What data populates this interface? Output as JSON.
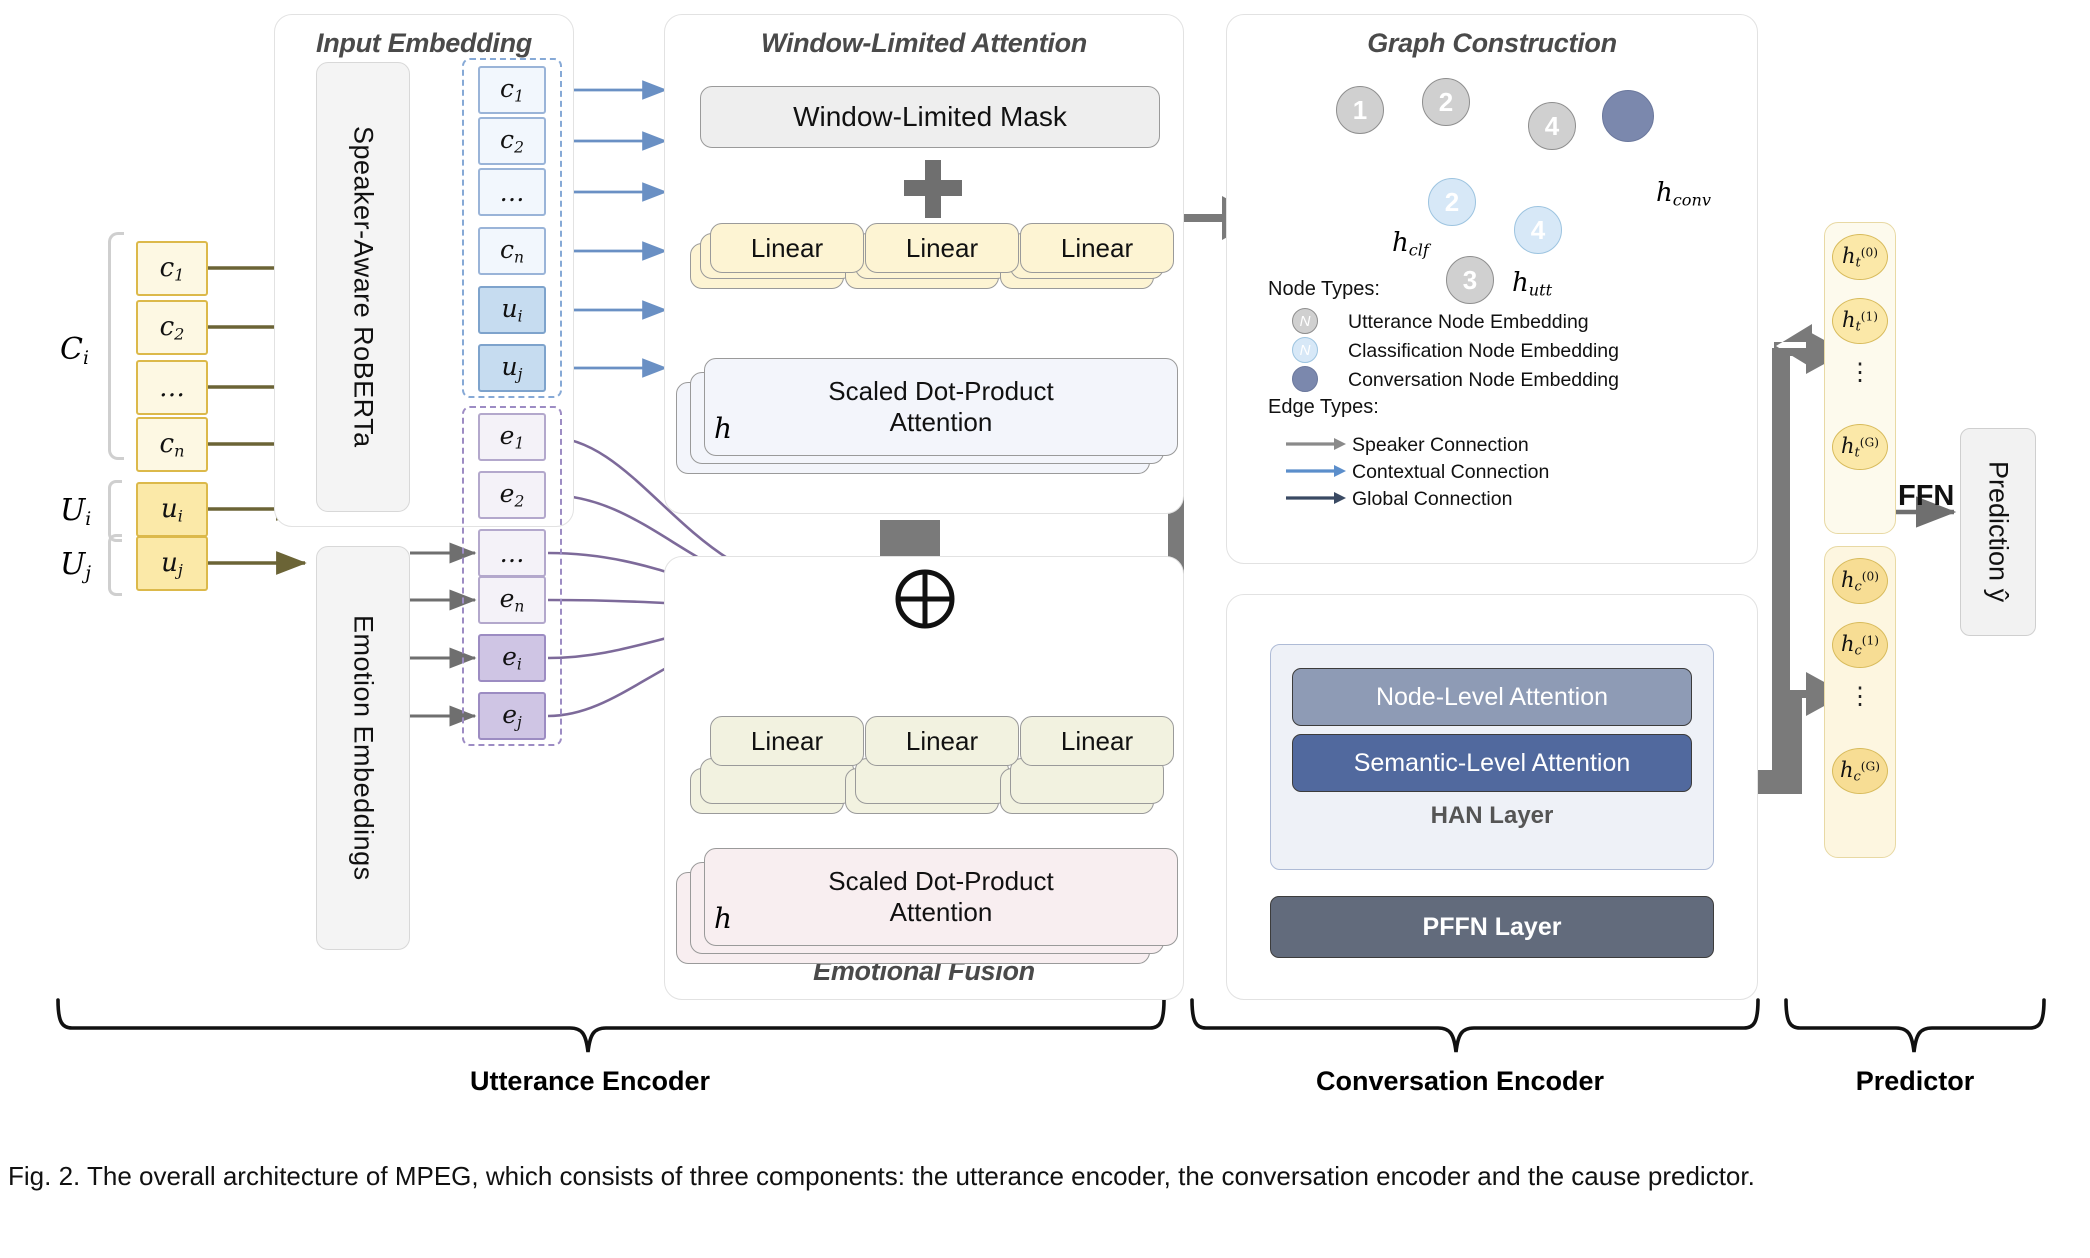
{
  "figure": {
    "caption": "Fig. 2. The overall architecture of MPEG, which consists of three components: the utterance encoder, the conversation encoder and the cause predictor."
  },
  "inputs": {
    "group_c_label": "C",
    "group_c_sub": "i",
    "group_ui_label": "U",
    "group_ui_sub": "i",
    "group_uj_label": "U",
    "group_uj_sub": "j",
    "context_tokens": [
      {
        "base": "c",
        "sub": "1"
      },
      {
        "base": "c",
        "sub": "2"
      },
      {
        "base": "…",
        "sub": ""
      },
      {
        "base": "c",
        "sub": "n"
      }
    ],
    "utterance_tokens": [
      {
        "base": "u",
        "sub": "i"
      },
      {
        "base": "u",
        "sub": "j"
      }
    ]
  },
  "input_embedding": {
    "title": "Input Embedding",
    "encoder_label": "Speaker-Aware RoBERTa",
    "emotion_label": "Emotion Embeddings",
    "text_embeddings": [
      {
        "base": "c",
        "sub": "1",
        "strong": false
      },
      {
        "base": "c",
        "sub": "2",
        "strong": false
      },
      {
        "base": "…",
        "sub": "",
        "strong": false
      },
      {
        "base": "c",
        "sub": "n",
        "strong": false
      },
      {
        "base": "u",
        "sub": "i",
        "strong": true
      },
      {
        "base": "u",
        "sub": "j",
        "strong": true
      }
    ],
    "emotion_embeddings": [
      {
        "base": "e",
        "sub": "1",
        "strong": false
      },
      {
        "base": "e",
        "sub": "2",
        "strong": false
      },
      {
        "base": "…",
        "sub": "",
        "strong": false
      },
      {
        "base": "e",
        "sub": "n",
        "strong": false
      },
      {
        "base": "e",
        "sub": "i",
        "strong": true
      },
      {
        "base": "e",
        "sub": "j",
        "strong": true
      }
    ]
  },
  "window_attention": {
    "title": "Window-Limited Attention",
    "mask_label": "Window-Limited Mask",
    "plus_symbol": "+",
    "linear_labels": [
      "Linear",
      "Linear",
      "Linear"
    ],
    "sdpa_label_line1": "Scaled Dot-Product",
    "sdpa_label_line2": "Attention",
    "heads_symbol": "h"
  },
  "emotional_fusion": {
    "title": "Emotional Fusion",
    "sum_symbol": "⊕",
    "linear_labels": [
      "Linear",
      "Linear",
      "Linear"
    ],
    "sdpa_label_line1": "Scaled Dot-Product",
    "sdpa_label_line2": "Attention",
    "heads_symbol": "h"
  },
  "graph_construction": {
    "title": "Graph Construction",
    "utterance_nodes": [
      "1",
      "2",
      "4",
      "3"
    ],
    "classification_nodes": [
      "2",
      "4"
    ],
    "conversation_node_label": "",
    "annotations": {
      "h_clf": {
        "base": "h",
        "sub": "clf"
      },
      "h_utt": {
        "base": "h",
        "sub": "utt"
      },
      "h_conv": {
        "base": "h",
        "sub": "conv"
      }
    },
    "node_types_heading": "Node Types:",
    "node_types": [
      {
        "glyph": "N",
        "label": "Utterance Node Embedding",
        "color": "#d0d0d0"
      },
      {
        "glyph": "N",
        "label": "Classification Node Embedding",
        "color": "#d7e8f7"
      },
      {
        "glyph": "",
        "label": "Conversation Node Embedding",
        "color": "#7b88ad"
      }
    ],
    "edge_types_heading": "Edge Types:",
    "edge_types": [
      {
        "label": "Speaker Connection",
        "color": "#8a8a8a"
      },
      {
        "label": "Contextual Connection",
        "color": "#5b8ecb"
      },
      {
        "label": "Global Connection",
        "color": "#3a4a63"
      }
    ]
  },
  "han": {
    "node_level_label": "Node-Level Attention",
    "semantic_level_label": "Semantic-Level Attention",
    "han_layer_label": "HAN Layer",
    "pffn_label": "PFFN Layer",
    "node_level_color": "#8e9bb5",
    "semantic_level_color": "#51699e",
    "pffn_color": "#626b7c"
  },
  "predictor": {
    "target_vectors": [
      {
        "base": "h",
        "sub": "t",
        "sup": "(0)"
      },
      {
        "base": "h",
        "sub": "t",
        "sup": "(1)"
      },
      {
        "base": "h",
        "sub": "t",
        "sup": "(G)"
      }
    ],
    "cause_vectors": [
      {
        "base": "h",
        "sub": "c",
        "sup": "(0)"
      },
      {
        "base": "h",
        "sub": "c",
        "sup": "(1)"
      },
      {
        "base": "h",
        "sub": "c",
        "sup": "(G)"
      }
    ],
    "vdots": "⋮",
    "ffn_label": "FFN",
    "prediction_label": "Prediction ŷ"
  },
  "sections": {
    "utterance_encoder": "Utterance Encoder",
    "conversation_encoder": "Conversation Encoder",
    "predictor": "Predictor"
  },
  "colors": {
    "gold": "#dcb94a",
    "blue": "#9ab4d8",
    "purple": "#9d8cc4",
    "gray_arrow": "#6b6b6b",
    "olive_arrow": "#6b6436"
  }
}
